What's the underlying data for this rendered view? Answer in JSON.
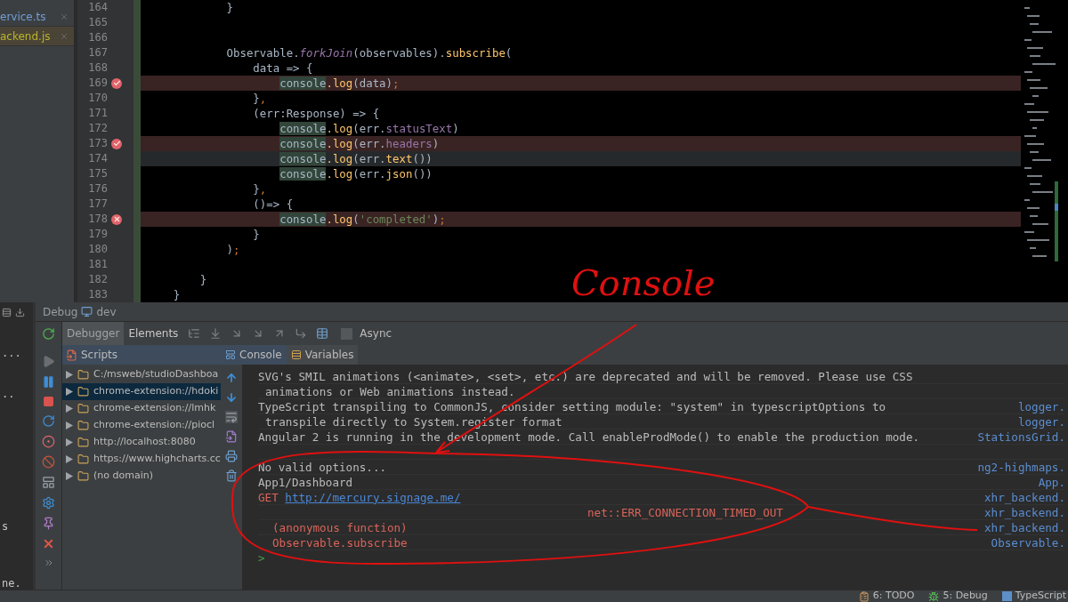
{
  "editor_tabs": [
    {
      "label": "ervice.ts",
      "kind": "ts",
      "selected": false
    },
    {
      "label": "ackend.js",
      "kind": "js",
      "selected": true
    }
  ],
  "code_lines": [
    {
      "number": "164",
      "current": false,
      "tokens": [
        {
          "text": "            }",
          "kind": "plain"
        }
      ]
    },
    {
      "number": "165",
      "current": false
    },
    {
      "number": "166",
      "current": false
    },
    {
      "number": "167",
      "current": false,
      "tokens": [
        {
          "text": "            Observable.",
          "kind": "plain"
        },
        {
          "text": "forkJoin",
          "kind": "static"
        },
        {
          "text": "(observables).",
          "kind": "plain"
        },
        {
          "text": "subscribe",
          "kind": "method"
        },
        {
          "text": "(",
          "kind": "plain"
        }
      ]
    },
    {
      "number": "168",
      "current": false,
      "tokens": [
        {
          "text": "                data => {",
          "kind": "plain"
        }
      ]
    },
    {
      "number": "169",
      "current": false,
      "breakpoint": {
        "kind": "verified"
      },
      "tokens": [
        {
          "text": "                    console",
          "kind": "match"
        },
        {
          "text": ".log",
          "kind": "method"
        },
        {
          "text": "(data)",
          "kind": "plain"
        },
        {
          "text": ";",
          "kind": "punct"
        }
      ]
    },
    {
      "number": "170",
      "current": false,
      "tokens": [
        {
          "text": "                }",
          "kind": "plain"
        },
        {
          "text": ",",
          "kind": "punct"
        }
      ]
    },
    {
      "number": "171",
      "current": false,
      "tokens": [
        {
          "text": "                (err:Response) => {",
          "kind": "plain"
        }
      ]
    },
    {
      "number": "172",
      "current": false,
      "tokens": [
        {
          "text": "                    console",
          "kind": "match"
        },
        {
          "text": ".log",
          "kind": "method"
        },
        {
          "text": "(err.",
          "kind": "plain"
        },
        {
          "text": "statusText",
          "kind": "prop"
        },
        {
          "text": ")",
          "kind": "plain"
        }
      ]
    },
    {
      "number": "173",
      "current": false,
      "breakpoint": {
        "kind": "verified"
      },
      "tokens": [
        {
          "text": "                    console",
          "kind": "match"
        },
        {
          "text": ".log",
          "kind": "method"
        },
        {
          "text": "(err.",
          "kind": "plain"
        },
        {
          "text": "headers",
          "kind": "prop"
        },
        {
          "text": ")",
          "kind": "plain"
        }
      ]
    },
    {
      "number": "174",
      "current": true,
      "tokens": [
        {
          "text": "                    console",
          "kind": "match"
        },
        {
          "text": ".log",
          "kind": "method"
        },
        {
          "text": "(err.",
          "kind": "plain"
        },
        {
          "text": "text",
          "kind": "method"
        },
        {
          "text": "())",
          "kind": "plain"
        }
      ]
    },
    {
      "number": "175",
      "current": false,
      "tokens": [
        {
          "text": "                    console",
          "kind": "match"
        },
        {
          "text": ".log",
          "kind": "method"
        },
        {
          "text": "(err.",
          "kind": "plain"
        },
        {
          "text": "json",
          "kind": "method"
        },
        {
          "text": "())",
          "kind": "plain"
        }
      ]
    },
    {
      "number": "176",
      "current": false,
      "tokens": [
        {
          "text": "                }",
          "kind": "plain"
        },
        {
          "text": ",",
          "kind": "punct"
        }
      ]
    },
    {
      "number": "177",
      "current": false,
      "tokens": [
        {
          "text": "                ()=> {",
          "kind": "plain"
        }
      ]
    },
    {
      "number": "178",
      "current": false,
      "breakpoint": {
        "kind": "invalid"
      },
      "tokens": [
        {
          "text": "                    console",
          "kind": "match"
        },
        {
          "text": ".log",
          "kind": "method"
        },
        {
          "text": "(",
          "kind": "plain"
        },
        {
          "text": "'completed'",
          "kind": "string"
        },
        {
          "text": ")",
          "kind": "plain"
        },
        {
          "text": ";",
          "kind": "punct"
        }
      ]
    },
    {
      "number": "179",
      "current": false,
      "tokens": [
        {
          "text": "                }",
          "kind": "plain"
        }
      ]
    },
    {
      "number": "180",
      "current": false,
      "tokens": [
        {
          "text": "            )",
          "kind": "plain"
        },
        {
          "text": ";",
          "kind": "punct"
        }
      ]
    },
    {
      "number": "181",
      "current": false
    },
    {
      "number": "182",
      "current": false,
      "tokens": [
        {
          "text": "        }",
          "kind": "plain"
        }
      ]
    },
    {
      "number": "183",
      "current": false,
      "tokens": [
        {
          "text": "    }",
          "kind": "plain"
        }
      ]
    }
  ],
  "left_panel_fragments": [
    "...",
    "..",
    "s",
    "ne."
  ],
  "debug": {
    "title": "Debug",
    "config": "dev",
    "tabs": [
      {
        "label": "Debugger",
        "selected": true
      },
      {
        "label": "Elements",
        "selected": false
      }
    ],
    "async": {
      "label": "Async",
      "checked": false
    },
    "scripts": {
      "title": "Scripts",
      "items": [
        {
          "label": "C:/msweb/studioDashboa",
          "selected": false
        },
        {
          "label": "chrome-extension://hdoki",
          "selected": true
        },
        {
          "label": "chrome-extension://lmhk",
          "selected": false
        },
        {
          "label": "chrome-extension://piocl",
          "selected": false
        },
        {
          "label": "http://localhost:8080",
          "selected": false
        },
        {
          "label": "https://www.highcharts.cc",
          "selected": false
        },
        {
          "label": "(no domain)",
          "selected": false
        }
      ]
    },
    "console_tabs": [
      {
        "label": "Console",
        "kind": "console",
        "selected": true
      },
      {
        "label": "Variables",
        "kind": "variables",
        "selected": false
      }
    ],
    "console": [
      {
        "kind": "log",
        "text": "SVG's SMIL animations (<animate>, <set>, etc.) are deprecated and will be removed. Please use CSS"
      },
      {
        "kind": "continuation",
        "text": "animations or Web animations instead."
      },
      {
        "kind": "log",
        "text": "TypeScript transpiling to CommonJS, consider setting module: \"system\" in typescriptOptions to",
        "source": "logger."
      },
      {
        "kind": "continuation",
        "text": "transpile directly to System.register format",
        "source": "logger."
      },
      {
        "kind": "log",
        "text": "Angular 2 is running in the development mode. Call enableProdMode() to enable the production mode.",
        "source": "StationsGrid."
      },
      {
        "kind": "blank"
      },
      {
        "kind": "log",
        "text": "No valid options...",
        "source": "ng2-highmaps."
      },
      {
        "kind": "log",
        "text": "App1/Dashboard",
        "source": "App."
      },
      {
        "kind": "error",
        "text": "GET",
        "link": "http://mercury.signage.me/",
        "source": "xhr_backend."
      },
      {
        "kind": "error-detail",
        "text": "net::ERR_CONNECTION_TIMED_OUT",
        "source": "xhr_backend."
      },
      {
        "kind": "stack",
        "text": "(anonymous function)",
        "source": "xhr_backend."
      },
      {
        "kind": "stack",
        "text": "Observable.subscribe",
        "source": "Observable."
      },
      {
        "kind": "prompt",
        "text": ">"
      }
    ]
  },
  "status_bar": [
    {
      "label": "6: TODO",
      "kind": "todo"
    },
    {
      "label": "5: Debug",
      "kind": "debug"
    },
    {
      "label": "TypeScript",
      "kind": "typescript"
    }
  ],
  "annotation": {
    "text": "Console"
  }
}
